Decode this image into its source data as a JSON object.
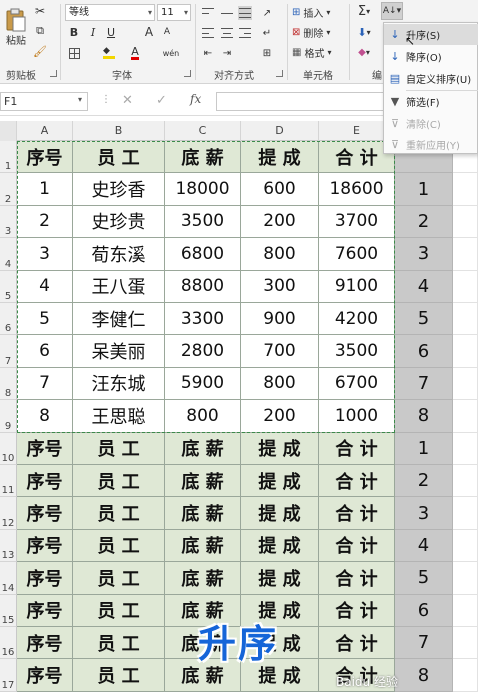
{
  "ribbon": {
    "clipboard": {
      "paste_label": "粘贴",
      "group_label": "剪贴板"
    },
    "font": {
      "font_name": "等线",
      "font_size": "11",
      "bold": "B",
      "italic": "I",
      "underline": "U",
      "grow": "A",
      "shrink": "A",
      "phonetic": "wén",
      "font_color_letter": "A",
      "group_label": "字体"
    },
    "alignment": {
      "group_label": "对齐方式"
    },
    "cells": {
      "insert_label": "插入",
      "delete_label": "删除",
      "format_label": "格式",
      "group_label": "单元格"
    },
    "editing": {
      "group_label_partial": "编"
    }
  },
  "formula_bar": {
    "name_box": "F1",
    "cancel_glyph": "✕",
    "enter_glyph": "✓",
    "fx_label": "fx"
  },
  "column_headers": [
    "A",
    "B",
    "C",
    "D",
    "E"
  ],
  "row_headers": [
    "1",
    "2",
    "3",
    "4",
    "5",
    "6",
    "7",
    "8",
    "9",
    "10",
    "11",
    "12",
    "13",
    "14",
    "15",
    "16",
    "17"
  ],
  "table": {
    "headers": [
      "序号",
      "员 工",
      "底 薪",
      "提 成",
      "合 计"
    ],
    "rows": [
      [
        "1",
        "史珍香",
        "18000",
        "600",
        "18600"
      ],
      [
        "2",
        "史珍贵",
        "3500",
        "200",
        "3700"
      ],
      [
        "3",
        "荀东溪",
        "6800",
        "800",
        "7600"
      ],
      [
        "4",
        "王八蛋",
        "8800",
        "300",
        "9100"
      ],
      [
        "5",
        "李健仁",
        "3300",
        "900",
        "4200"
      ],
      [
        "6",
        "呆美丽",
        "2800",
        "700",
        "3500"
      ],
      [
        "7",
        "汪东城",
        "5900",
        "800",
        "6700"
      ],
      [
        "8",
        "王思聪",
        "800",
        "200",
        "1000"
      ]
    ],
    "repeated_header_rows": 8
  },
  "helper_column": [
    "1",
    "2",
    "3",
    "4",
    "5",
    "6",
    "7",
    "8",
    "1",
    "2",
    "3",
    "4",
    "5",
    "6",
    "7",
    "8"
  ],
  "sort_menu": {
    "items": [
      {
        "label": "升序(S)",
        "icon": "sort-ascending-icon",
        "enabled": true,
        "highlighted": true
      },
      {
        "label": "降序(O)",
        "icon": "sort-descending-icon",
        "enabled": true,
        "highlighted": false
      },
      {
        "label": "自定义排序(U)",
        "icon": "custom-sort-icon",
        "enabled": true,
        "highlighted": false
      },
      {
        "label": "筛选(F)",
        "icon": "filter-icon",
        "enabled": true,
        "highlighted": false
      },
      {
        "label": "清除(C)",
        "icon": "clear-filter-icon",
        "enabled": false,
        "highlighted": false
      },
      {
        "label": "重新应用(Y)",
        "icon": "reapply-icon",
        "enabled": false,
        "highlighted": false
      }
    ]
  },
  "caption": "升序",
  "watermark": "Baidu 经验",
  "colors": {
    "header_fill": "#dfe8d5",
    "helper_fill": "#c9c9c9",
    "caption_blue": "#1565d8",
    "ribbon_bg": "#f3f3f3"
  }
}
